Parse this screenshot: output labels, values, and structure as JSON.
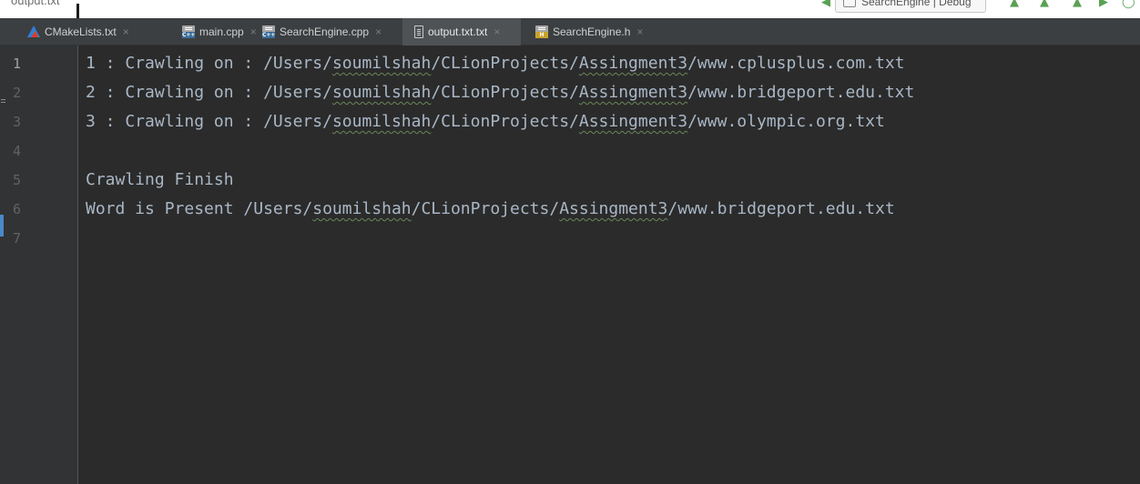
{
  "toolbar": {
    "crumb": "output.txt",
    "config": "SearchEngine | Debug"
  },
  "tabs": [
    {
      "label": "CMakeLists.txt",
      "icon": "cmake-icon"
    },
    {
      "label": "main.cpp",
      "icon": "cpp-file-icon"
    },
    {
      "label": "SearchEngine.cpp",
      "icon": "cpp-file-icon"
    },
    {
      "label": "output.txt.txt",
      "icon": "text-file-icon",
      "active": true
    },
    {
      "label": "SearchEngine.h",
      "icon": "header-file-icon"
    }
  ],
  "tab_close": "×",
  "editor": {
    "line_numbers": [
      "1",
      "2",
      "3",
      "4",
      "5",
      "6",
      "7"
    ],
    "lines": [
      {
        "pre": "1 : Crawling on : /Users/",
        "w1": "soumilshah",
        "mid": "/CLionProjects/",
        "w2": "Assingment3",
        "post": "/www.cplusplus.com.txt"
      },
      {
        "pre": "2 : Crawling on : /Users/",
        "w1": "soumilshah",
        "mid": "/CLionProjects/",
        "w2": "Assingment3",
        "post": "/www.bridgeport.edu.txt"
      },
      {
        "pre": "3 : Crawling on : /Users/",
        "w1": "soumilshah",
        "mid": "/CLionProjects/",
        "w2": "Assingment3",
        "post": "/www.olympic.org.txt"
      },
      {
        "text": ""
      },
      {
        "text": "Crawling Finish"
      },
      {
        "pre": "Word is Present /Users/",
        "w1": "soumilshah",
        "mid": "/CLionProjects/",
        "w2": "Assingment3",
        "post": "/www.bridgeport.edu.txt"
      },
      {
        "text": ""
      }
    ]
  },
  "colors": {
    "editor_bg": "#2b2b2b",
    "gutter_bg": "#313335",
    "text": "#a9b7c6",
    "line_number": "#606366",
    "tab_bar": "#3c3f41",
    "tab_active": "#4e5254",
    "typo_underline": "#6a8759"
  }
}
